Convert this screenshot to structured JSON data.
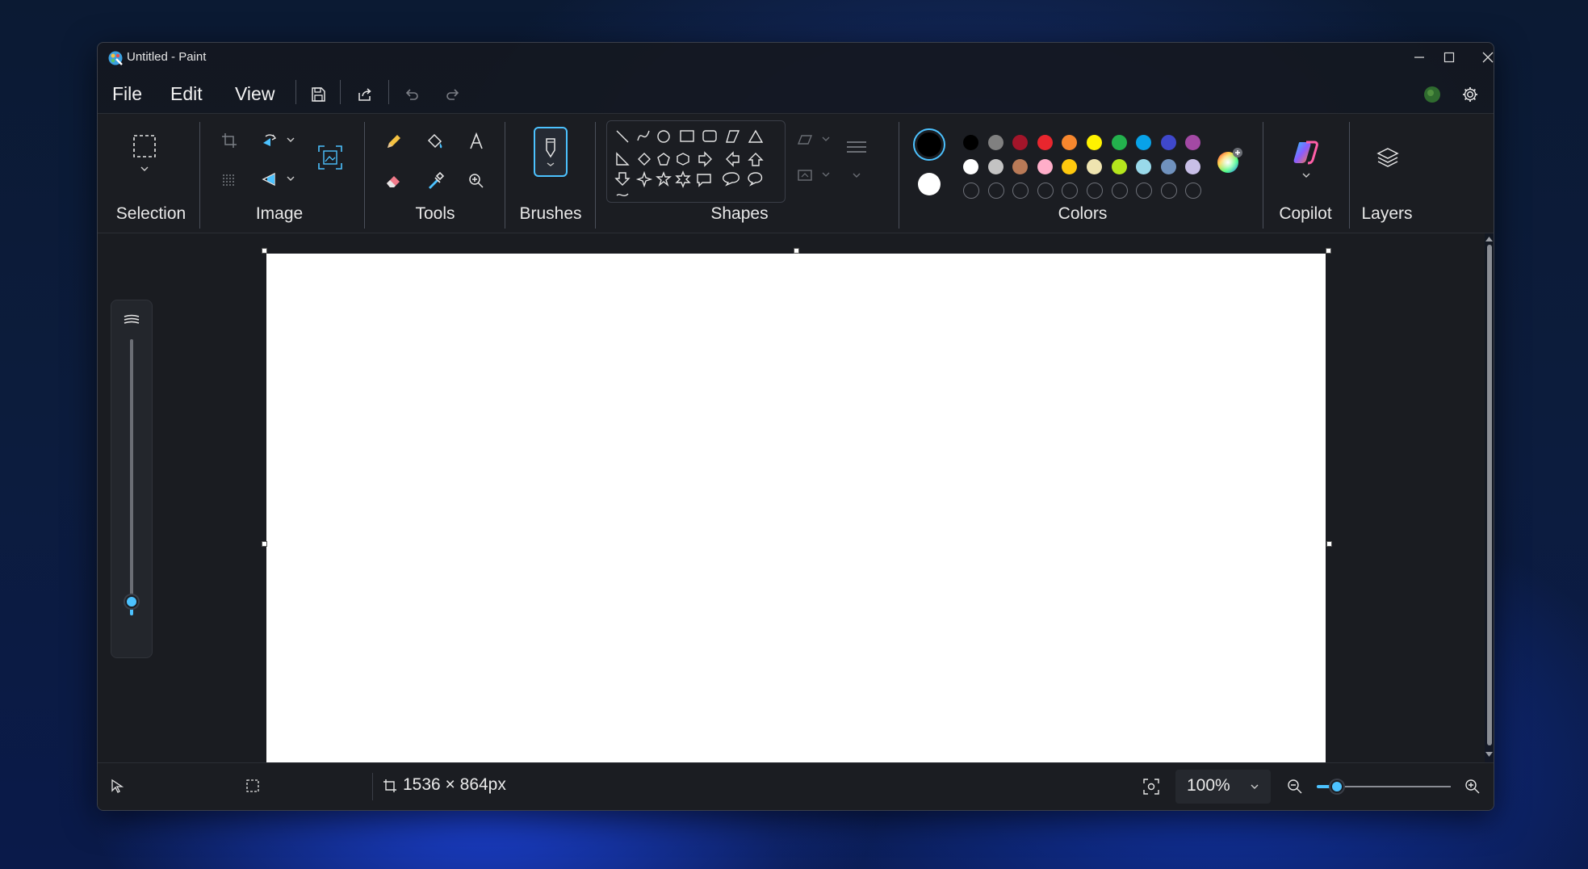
{
  "window": {
    "title": "Untitled - Paint"
  },
  "menu": {
    "file": "File",
    "edit": "Edit",
    "view": "View"
  },
  "ribbon": {
    "groups": {
      "selection": "Selection",
      "image": "Image",
      "tools": "Tools",
      "brushes": "Brushes",
      "shapes": "Shapes",
      "colors": "Colors",
      "copilot": "Copilot",
      "layers": "Layers"
    },
    "colors": {
      "primary": "#000000",
      "secondary": "#ffffff",
      "palette_row1": [
        "#000000",
        "#808080",
        "#a3152a",
        "#e8262e",
        "#f7872e",
        "#fff200",
        "#23b14d",
        "#08a2e8",
        "#3f48cc",
        "#a349a4"
      ],
      "palette_row2": [
        "#ffffff",
        "#c3c3c3",
        "#b97a57",
        "#ffaec9",
        "#ffc90e",
        "#efe4b0",
        "#b5e61d",
        "#99d9ea",
        "#7092be",
        "#c8bfe7"
      ],
      "accent": "#4cc2ff"
    },
    "shapes": [
      "line",
      "curve",
      "oval",
      "rectangle",
      "rounded-rectangle",
      "polygon",
      "triangle",
      "right-triangle",
      "diamond",
      "pentagon",
      "hexagon",
      "right-arrow",
      "left-arrow",
      "up-arrow",
      "down-arrow",
      "four-point-star",
      "five-point-star",
      "six-point-star",
      "rounded-callout",
      "oval-callout",
      "cloud-callout"
    ]
  },
  "status": {
    "canvas_size": "1536 × 864px",
    "zoom": "100%",
    "zoom_slider_fraction": 0.15,
    "brush_size_fraction": 0.02
  }
}
